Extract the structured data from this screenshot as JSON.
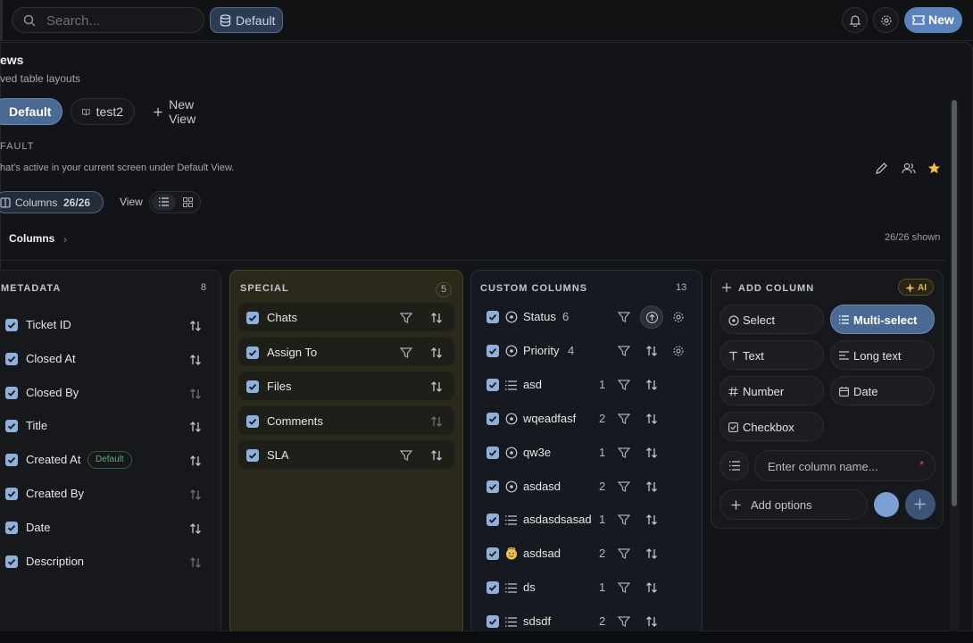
{
  "topbar": {
    "search_placeholder": "Search...",
    "view_pill": "Default",
    "new_label": "New"
  },
  "page": {
    "title": "ews",
    "subtitle": "ved table layouts"
  },
  "view_tabs": [
    {
      "label": "Default"
    },
    {
      "label": "test2"
    },
    {
      "label": "New View"
    }
  ],
  "section": {
    "label": "FAULT",
    "desc": "hat's active in your current screen under Default View."
  },
  "toolbar": {
    "columns_label": "Columns",
    "columns_count": "26/26",
    "view_label": "View"
  },
  "columns_header": {
    "label": "Columns",
    "shown": "26/26 shown"
  },
  "metadata": {
    "title": "METADATA",
    "count": "8",
    "default_badge": "Default",
    "items": [
      "Ticket ID",
      "Closed At",
      "Closed By",
      "Title",
      "Created At",
      "Created By",
      "Date",
      "Description"
    ]
  },
  "special": {
    "title": "SPECIAL",
    "count": "5",
    "items": [
      "Chats",
      "Assign To",
      "Files",
      "Comments",
      "SLA"
    ]
  },
  "custom": {
    "title": "CUSTOM COLUMNS",
    "count": "13",
    "items": [
      {
        "label": "Status",
        "count": "6",
        "icon": "circle-dot-icon"
      },
      {
        "label": "Priority",
        "count": "4",
        "icon": "circle-dot-icon"
      },
      {
        "label": "asd",
        "count": "1",
        "icon": "list-icon"
      },
      {
        "label": "wqeadfasf",
        "count": "2",
        "icon": "circle-dot-icon"
      },
      {
        "label": "qw3e",
        "count": "1",
        "icon": "circle-dot-icon"
      },
      {
        "label": "asdasd",
        "count": "2",
        "icon": "circle-dot-icon"
      },
      {
        "label": "asdasdsasad",
        "count": "1",
        "icon": "list-icon"
      },
      {
        "label": "asdsad",
        "count": "2",
        "icon": "emoji-icon"
      },
      {
        "label": "ds",
        "count": "1",
        "icon": "list-icon"
      },
      {
        "label": "sdsdf",
        "count": "2",
        "icon": "list-icon"
      }
    ]
  },
  "add_column": {
    "title": "ADD COLUMN",
    "ai_label": "AI",
    "types": [
      "Select",
      "Multi-select",
      "Text",
      "Long text",
      "Number",
      "Date",
      "Checkbox"
    ],
    "name_placeholder": "Enter column name...",
    "required_mark": "*",
    "add_options": "Add options",
    "color": "#7c9fd4"
  }
}
